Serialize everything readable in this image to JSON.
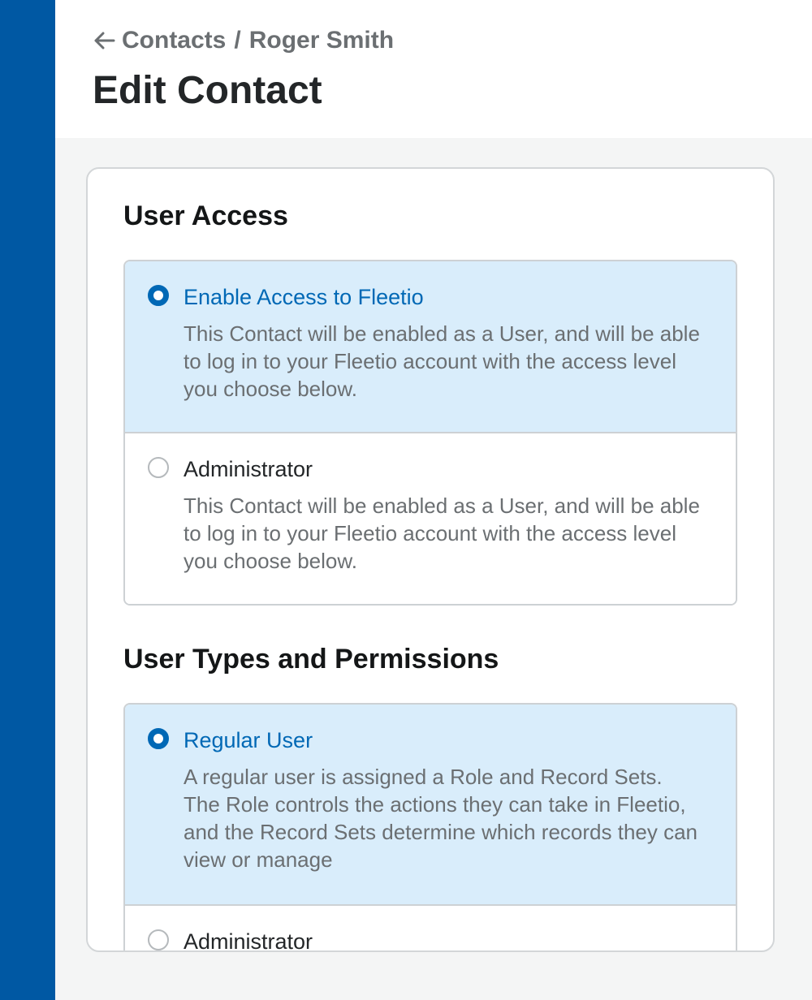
{
  "header": {
    "breadcrumb_root": "Contacts",
    "breadcrumb_separator": "/",
    "breadcrumb_current": "Roger Smith",
    "title": "Edit Contact"
  },
  "user_access": {
    "title": "User Access",
    "options": [
      {
        "label": "Enable Access to Fleetio",
        "description": "This Contact will be enabled as a User, and will be able to log in to your Fleetio account with the access level you choose below.",
        "selected": true
      },
      {
        "label": "Administrator",
        "description": "This Contact will be enabled as a User, and will be able to log in to your Fleetio account with the access level you choose below.",
        "selected": false
      }
    ]
  },
  "user_types": {
    "title": "User Types and Permissions",
    "options": [
      {
        "label": "Regular User",
        "description": "A regular user is assigned a Role and Record Sets. The Role controls the actions they can take in Fleetio, and the Record Sets determine which records they can view or manage",
        "selected": true
      },
      {
        "label": "Administrator",
        "description": "",
        "selected": false
      }
    ]
  },
  "colors": {
    "side_rail": "#0058a3",
    "accent": "#0068b5",
    "selected_bg": "#d9edfb"
  }
}
